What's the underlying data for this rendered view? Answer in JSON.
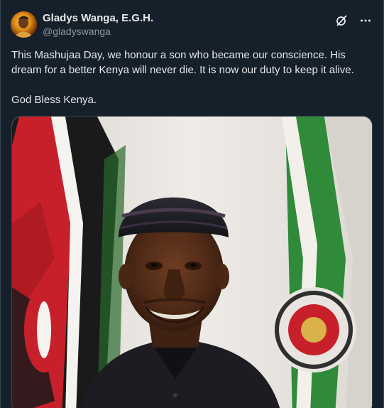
{
  "post": {
    "author": {
      "display_name": "Gladys Wanga, E.G.H.",
      "handle": "@gladyswanga",
      "avatar_icon": "profile-avatar"
    },
    "actions": [
      {
        "name": "grok-icon"
      },
      {
        "name": "more-options-icon",
        "glyph": "···"
      }
    ],
    "body": {
      "line1": "This Mashujaa Day, we honour a son who became our conscience. His dream for a better Kenya will never die. It is now our duty to keep it alive.",
      "line2": "God Bless Kenya."
    },
    "media": {
      "type": "photo",
      "subject": "portrait-photo"
    }
  },
  "colors": {
    "background": "#15202b",
    "text": "#e7e9ea",
    "secondary_text": "#8b98a5",
    "border": "#38444d"
  }
}
